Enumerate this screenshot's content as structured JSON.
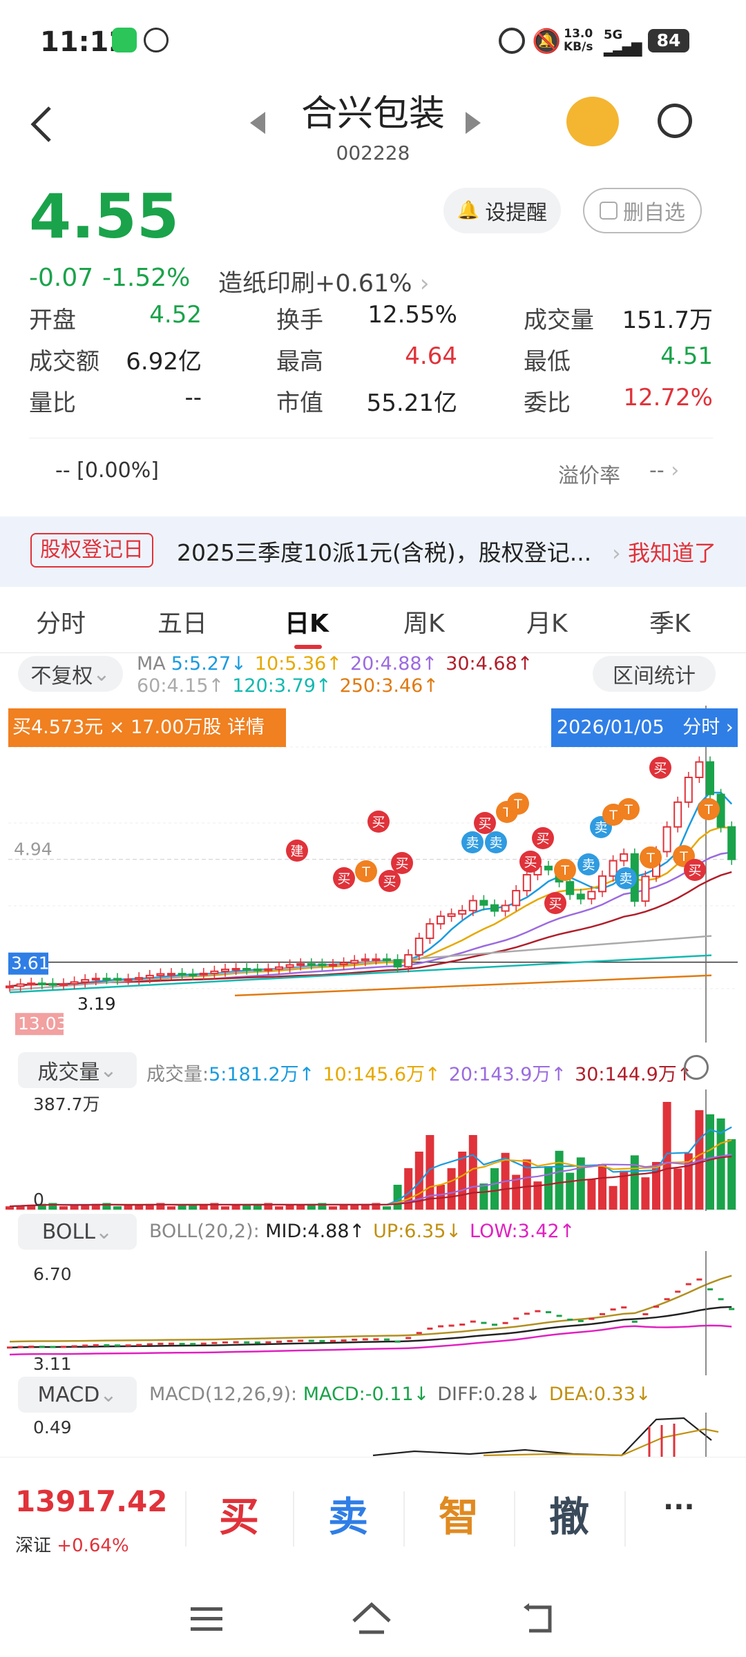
{
  "status": {
    "time": "11:12",
    "net_speed": "13.0",
    "net_unit": "KB/s",
    "net_type": "5G",
    "battery": "84"
  },
  "header": {
    "name": "合兴包装",
    "code": "002228"
  },
  "quote": {
    "price": "4.55",
    "change": "-0.07",
    "pct": "-1.52%",
    "sector": "造纸印刷",
    "sector_pct": "+0.61%",
    "alert_btn": "设提醒",
    "remove_btn": "删自选",
    "rows": [
      [
        {
          "l": "开盘",
          "v": "4.52",
          "c": "green"
        },
        {
          "l": "换手",
          "v": "12.55%",
          "c": "dark"
        },
        {
          "l": "成交量",
          "v": "151.7万",
          "c": "dark"
        }
      ],
      [
        {
          "l": "成交额",
          "v": "6.92亿",
          "c": "dark"
        },
        {
          "l": "最高",
          "v": "4.64",
          "c": "red"
        },
        {
          "l": "最低",
          "v": "4.51",
          "c": "green"
        }
      ],
      [
        {
          "l": "量比",
          "v": "--",
          "c": "dark"
        },
        {
          "l": "市值",
          "v": "55.21亿",
          "c": "dark"
        },
        {
          "l": "委比",
          "v": "12.72%",
          "c": "red"
        }
      ]
    ],
    "premium_left": "--  [0.00%]",
    "premium_label": "溢价率",
    "premium_val": "--"
  },
  "notice": {
    "tag": "股权登记日",
    "text": "2025三季度10派1元(含税)，股权登记...",
    "action": "我知道了"
  },
  "tabs": [
    "分时",
    "五日",
    "日K",
    "周K",
    "月K",
    "季K"
  ],
  "active_tab": "日K",
  "kline": {
    "adj": "不复权",
    "range_btn": "区间统计",
    "ma_label": "MA",
    "ma": [
      {
        "t": "5:5.27↓",
        "c": "#1a9be0"
      },
      {
        "t": "10:5.36↑",
        "c": "#e6a800"
      },
      {
        "t": "20:4.88↑",
        "c": "#9b6bdf"
      },
      {
        "t": "30:4.68↑",
        "c": "#b01e2a"
      }
    ],
    "ma2": [
      {
        "t": "60:4.15↑",
        "c": "#aaaaaa"
      },
      {
        "t": "120:3.79↑",
        "c": "#14b8b0"
      },
      {
        "t": "250:3.46↑",
        "c": "#e07a10"
      }
    ],
    "buy_banner": "买4.573元 × 17.00万股 详情",
    "date_banner": "2026/01/05",
    "date_link": "分时",
    "y_top": "4.94",
    "y_cur": "3.61",
    "y_low": "3.19",
    "y_low2": "13.03"
  },
  "volume": {
    "label": "成交量",
    "title": "成交量:",
    "items": [
      {
        "t": "5:181.2万↑",
        "c": "#1a9be0"
      },
      {
        "t": "10:145.6万↑",
        "c": "#e6a800"
      },
      {
        "t": "20:143.9万↑",
        "c": "#9b6bdf"
      },
      {
        "t": "30:144.9万↑",
        "c": "#b01e2a"
      }
    ],
    "y_top": "387.7万",
    "y_zero": "0"
  },
  "boll": {
    "label": "BOLL",
    "title": "BOLL(20,2):",
    "items": [
      {
        "t": "MID:4.88↑",
        "c": "#222222"
      },
      {
        "t": "UP:6.35↓",
        "c": "#c09010"
      },
      {
        "t": "LOW:3.42↑",
        "c": "#e020c0"
      }
    ],
    "y_top": "6.70",
    "y_low": "3.11"
  },
  "macd": {
    "label": "MACD",
    "title": "MACD(12,26,9):",
    "items": [
      {
        "t": "MACD:-0.11↓",
        "c": "#1aa34a"
      },
      {
        "t": "DIFF:0.28↓",
        "c": "#666666"
      },
      {
        "t": "DEA:0.33↓",
        "c": "#c09010"
      }
    ],
    "y_top": "0.49"
  },
  "bottom": {
    "index_val": "13917.42",
    "index_name": "深证",
    "index_pct": "+0.64%",
    "buy": "买",
    "sell": "卖",
    "smart": "智",
    "cancel": "撤"
  },
  "markers": {
    "build": "建",
    "buy": "买",
    "sell": "卖",
    "t": "T"
  }
}
